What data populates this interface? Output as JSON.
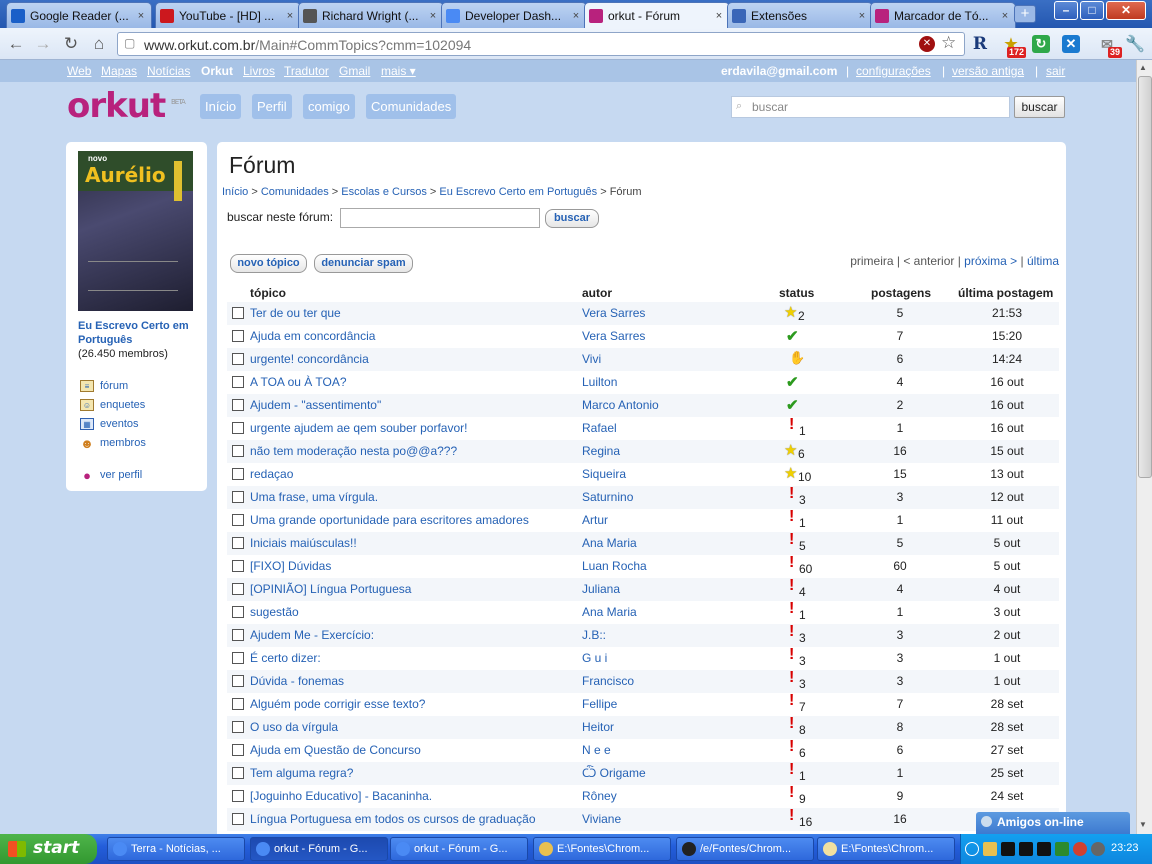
{
  "browser": {
    "tabs": [
      {
        "title": "Google Reader (...",
        "icon": "google-reader-icon",
        "color": "#1a5fc8",
        "active": false
      },
      {
        "title": "YouTube - [HD] ...",
        "icon": "youtube-icon",
        "color": "#cc181e",
        "active": false
      },
      {
        "title": "Richard Wright (...",
        "icon": "wikipedia-icon",
        "color": "#555555",
        "active": false
      },
      {
        "title": "Developer Dash...",
        "icon": "chrome-icon",
        "color": "#4a8af4",
        "active": false
      },
      {
        "title": "orkut - Fórum",
        "icon": "orkut-icon",
        "color": "#b8227d",
        "active": true
      },
      {
        "title": "Extensões",
        "icon": "puzzle-icon",
        "color": "#3a66b8",
        "active": false
      },
      {
        "title": "Marcador de Tó...",
        "icon": "orkut-icon",
        "color": "#b8227d",
        "active": false
      }
    ],
    "url": "www.orkut.com.br",
    "url_path": "/Main#CommTopics?cmm=102094",
    "ext_badges": [
      "172",
      "39"
    ]
  },
  "orkut_bar": {
    "links": [
      "Web",
      "Mapas",
      "Notícias",
      "Orkut",
      "Livros",
      "Tradutor",
      "Gmail",
      "mais ▾"
    ],
    "user": "erdavila@gmail.com",
    "right_links": [
      "configurações",
      "versão antiga",
      "sair"
    ]
  },
  "header": {
    "logo": "orkut",
    "beta": "BETA",
    "nav": [
      "Início",
      "Perfil",
      "comigo",
      "Comunidades"
    ],
    "search_placeholder": "buscar",
    "search_button": "buscar"
  },
  "community": {
    "cover_title": "Aurélio",
    "cover_tag": "novo",
    "name": "Eu Escrevo Certo em Português",
    "members": "(26.450 membros)",
    "menu": [
      {
        "label": "fórum",
        "icon": "forum-icon"
      },
      {
        "label": "enquetes",
        "icon": "poll-icon"
      },
      {
        "label": "eventos",
        "icon": "calendar-icon"
      },
      {
        "label": "membros",
        "icon": "members-icon"
      }
    ],
    "profile_link": "ver perfil"
  },
  "forum": {
    "title": "Fórum",
    "breadcrumb": [
      "Início",
      "Comunidades",
      "Escolas e Cursos",
      "Eu Escrevo Certo em Português"
    ],
    "breadcrumb_current": "Fórum",
    "search_label": "buscar neste fórum:",
    "search_button": "buscar",
    "new_topic": "novo tópico",
    "report_spam": "denunciar spam",
    "pager": {
      "first": "primeira",
      "prev": "< anterior",
      "next": "próxima >",
      "last": "última"
    },
    "columns": [
      "tópico",
      "autor",
      "status",
      "postagens",
      "última postagem"
    ],
    "topics": [
      {
        "topic": "Ter de ou ter que",
        "author": "Vera Sarres",
        "status": "star",
        "count": "2",
        "posts": "5",
        "last": "21:53"
      },
      {
        "topic": "Ajuda em concordância",
        "author": "Vera Sarres",
        "status": "check",
        "count": "",
        "posts": "7",
        "last": "15:20"
      },
      {
        "topic": "urgente! concordância",
        "author": "Vivi",
        "status": "hand",
        "count": "",
        "posts": "6",
        "last": "14:24"
      },
      {
        "topic": "A TOA ou À TOA?",
        "author": "Luilton",
        "status": "check",
        "count": "",
        "posts": "4",
        "last": "16 out"
      },
      {
        "topic": "Ajudem - \"assentimento\"",
        "author": "Marco Antonio",
        "status": "check",
        "count": "",
        "posts": "2",
        "last": "16 out"
      },
      {
        "topic": "urgente ajudem ae qem souber porfavor!",
        "author": "Rafael",
        "status": "excl",
        "count": "1",
        "posts": "1",
        "last": "16 out"
      },
      {
        "topic": "não tem moderação nesta po@@a???",
        "author": "Regina",
        "status": "star",
        "count": "6",
        "posts": "16",
        "last": "15 out"
      },
      {
        "topic": "redaçao",
        "author": "Siqueira",
        "status": "star",
        "count": "10",
        "posts": "15",
        "last": "13 out"
      },
      {
        "topic": "Uma frase, uma vírgula.",
        "author": "Saturnino",
        "status": "excl",
        "count": "3",
        "posts": "3",
        "last": "12 out"
      },
      {
        "topic": "Uma grande oportunidade para escritores amadores",
        "author": "Artur",
        "status": "excl",
        "count": "1",
        "posts": "1",
        "last": "11 out"
      },
      {
        "topic": "Iniciais maiúsculas!!",
        "author": "Ana Maria",
        "status": "excl",
        "count": "5",
        "posts": "5",
        "last": "5 out"
      },
      {
        "topic": "[FIXO] Dúvidas",
        "author": "Luan Rocha",
        "status": "excl",
        "count": "60",
        "posts": "60",
        "last": "5 out"
      },
      {
        "topic": "[OPINIÃO] Língua Portuguesa",
        "author": "Juliana",
        "status": "excl",
        "count": "4",
        "posts": "4",
        "last": "4 out"
      },
      {
        "topic": "sugestão",
        "author": "Ana Maria",
        "status": "excl",
        "count": "1",
        "posts": "1",
        "last": "3 out"
      },
      {
        "topic": "Ajudem Me - Exercício:",
        "author": "J.B::",
        "status": "excl",
        "count": "3",
        "posts": "3",
        "last": "2 out"
      },
      {
        "topic": "É certo dizer:",
        "author": "G u i",
        "status": "excl",
        "count": "3",
        "posts": "3",
        "last": "1 out"
      },
      {
        "topic": "Dúvida - fonemas",
        "author": "Francisco",
        "status": "excl",
        "count": "3",
        "posts": "3",
        "last": "1 out"
      },
      {
        "topic": "Alguém pode corrigir esse texto?",
        "author": "Fellipe",
        "status": "excl",
        "count": "7",
        "posts": "7",
        "last": "28 set"
      },
      {
        "topic": "O uso da vírgula",
        "author": "Heitor",
        "status": "excl",
        "count": "8",
        "posts": "8",
        "last": "28 set"
      },
      {
        "topic": "Ajuda em Questão de Concurso",
        "author": "N e e",
        "status": "excl",
        "count": "6",
        "posts": "6",
        "last": "27 set"
      },
      {
        "topic": "Tem alguma regra?",
        "author": "Ѽ Origame",
        "status": "excl",
        "count": "1",
        "posts": "1",
        "last": "25 set"
      },
      {
        "topic": "[Joguinho Educativo] - Bacaninha.",
        "author": "Rôney",
        "status": "excl",
        "count": "9",
        "posts": "9",
        "last": "24 set"
      },
      {
        "topic": "Língua Portuguesa em todos os cursos de graduação",
        "author": "Viviane",
        "status": "excl",
        "count": "16",
        "posts": "16",
        "last": ""
      }
    ]
  },
  "amigos": "Amigos on-line",
  "taskbar": {
    "start": "start",
    "items": [
      {
        "label": "Terra - Notícias, ...",
        "color": "#4a8af4"
      },
      {
        "label": "orkut - Fórum - G...",
        "color": "#4a8af4"
      },
      {
        "label": "orkut - Fórum - G...",
        "color": "#4a8af4"
      },
      {
        "label": "E:\\Fontes\\Chrom...",
        "color": "#e8c050"
      },
      {
        "label": "/e/Fontes/Chrom...",
        "color": "#222222"
      },
      {
        "label": "E:\\Fontes\\Chrom...",
        "color": "#f0e0a0"
      }
    ],
    "clock": "23:23"
  }
}
